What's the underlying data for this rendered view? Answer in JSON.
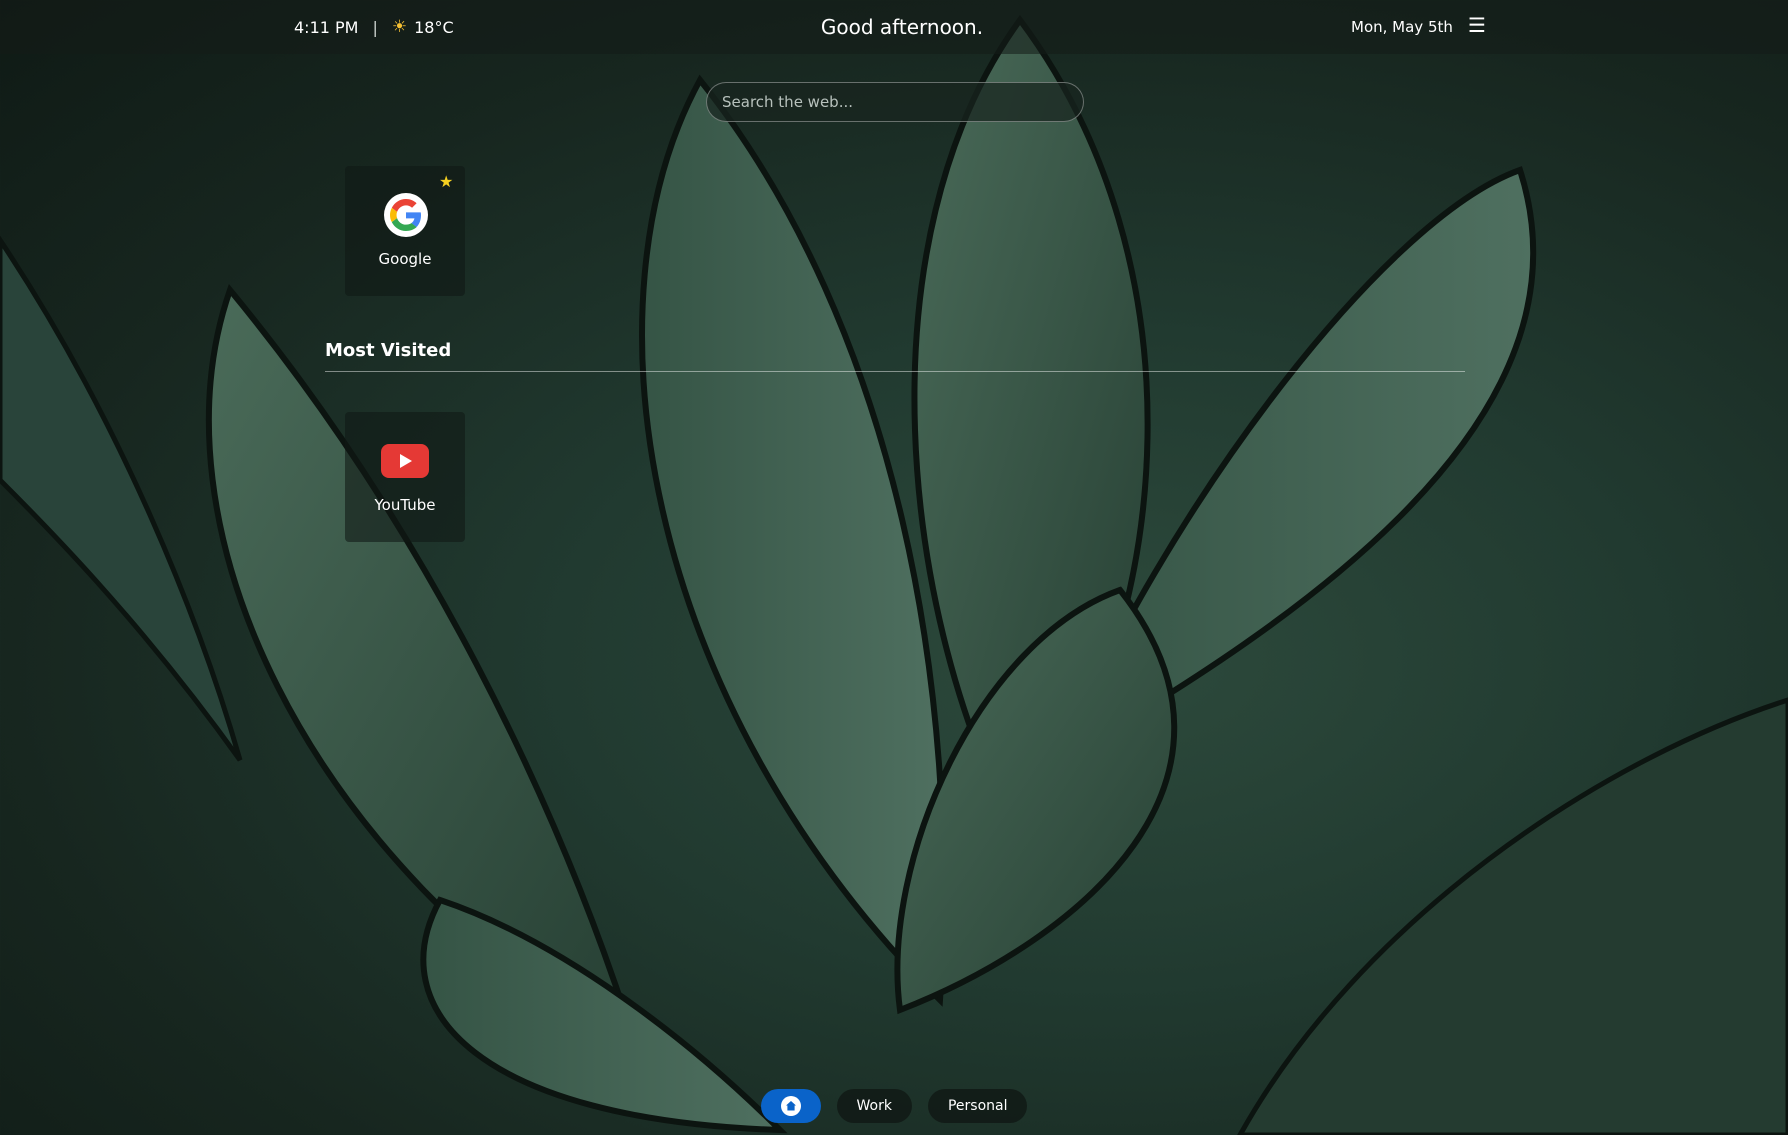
{
  "header": {
    "time": "4:11 PM",
    "separator": "|",
    "weather_icon": "sun-icon",
    "temperature": "18°C",
    "greeting": "Good afternoon.",
    "date": "Mon, May 5th",
    "menu_icon": "hamburger-menu-icon"
  },
  "search": {
    "placeholder": "Search the web..."
  },
  "favorites": [
    {
      "label": "Google",
      "icon": "google-icon",
      "starred": true
    }
  ],
  "most_visited": {
    "title": "Most Visited",
    "items": [
      {
        "label": "YouTube",
        "icon": "youtube-icon"
      }
    ]
  },
  "bottom_nav": {
    "tabs": [
      {
        "icon": "home-icon",
        "active": true
      },
      {
        "label": "Work"
      },
      {
        "label": "Personal"
      }
    ],
    "active_color": "#0a63c9"
  }
}
